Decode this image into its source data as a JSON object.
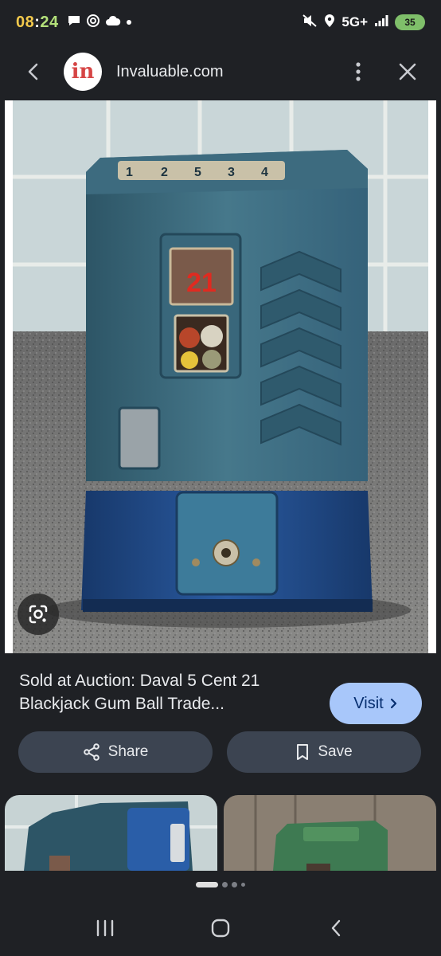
{
  "status_bar": {
    "time_hours": "08",
    "time_sep": ":",
    "time_minutes": "24",
    "network": "5G+",
    "battery": "35"
  },
  "header": {
    "site_logo_text": "in",
    "site_name": "Invaluable.com"
  },
  "result": {
    "title": "Sold at Auction: Daval 5 Cent 21 Blackjack Gum Ball Trade...",
    "visit_label": "Visit"
  },
  "actions": {
    "share_label": "Share",
    "save_label": "Save"
  },
  "photo": {
    "counter_digits": [
      "1",
      "2",
      "5",
      "3",
      "4"
    ],
    "badge_text": "21"
  },
  "icons": {
    "back": "back-arrow-icon",
    "more": "more-vert-icon",
    "close": "close-icon",
    "lens": "google-lens-icon",
    "share": "share-icon",
    "save": "bookmark-icon",
    "visit": "chevron-right-icon"
  },
  "colors": {
    "background": "#1f2125",
    "visit_button": "#a8c7fa",
    "action_button": "#3c4451",
    "machine_teal": "#3f6b7e",
    "machine_base_blue": "#1f4a85"
  }
}
